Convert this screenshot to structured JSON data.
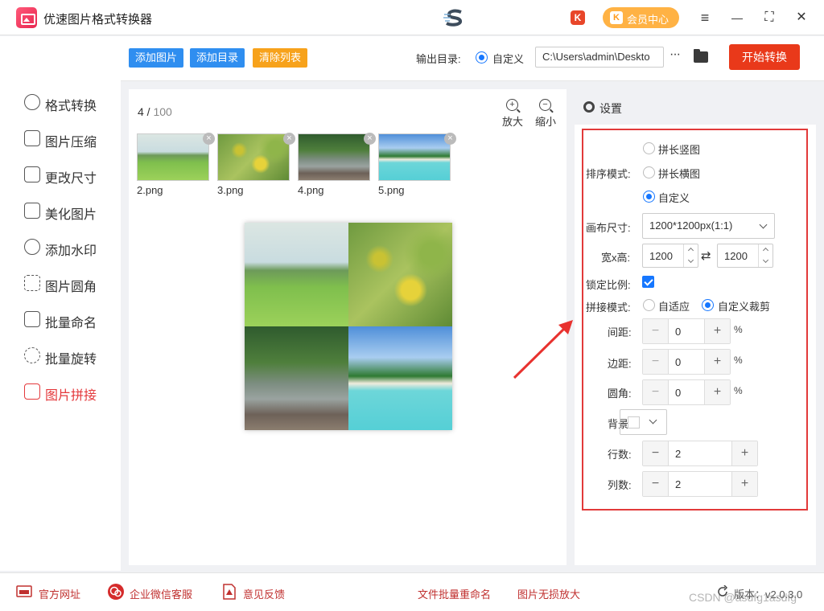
{
  "app": {
    "title": "优速图片格式转换器",
    "center_logo_text": "ら"
  },
  "titlebar": {
    "vip_label": "会员中心",
    "k_badge": "K",
    "menu_glyph": "≡",
    "min_glyph": "—",
    "max_glyph": "⛶",
    "close_glyph": "✕"
  },
  "sidebar": {
    "items": [
      {
        "label": "格式转换",
        "icon": "format-convert-icon"
      },
      {
        "label": "图片压缩",
        "icon": "compress-icon"
      },
      {
        "label": "更改尺寸",
        "icon": "resize-icon"
      },
      {
        "label": "美化图片",
        "icon": "beautify-icon"
      },
      {
        "label": "添加水印",
        "icon": "watermark-icon"
      },
      {
        "label": "图片圆角",
        "icon": "round-corner-icon"
      },
      {
        "label": "批量命名",
        "icon": "rename-icon"
      },
      {
        "label": "批量旋转",
        "icon": "rotate-icon"
      },
      {
        "label": "图片拼接",
        "icon": "stitch-icon",
        "active": true
      }
    ]
  },
  "toolbar": {
    "add_image": "添加图片",
    "add_dir": "添加目录",
    "clear_list": "清除列表",
    "output_label": "输出目录:",
    "output_mode": "自定义",
    "output_path": "C:\\Users\\admin\\Deskto",
    "more_glyph": "···",
    "start": "开始转换",
    "colors": {
      "add": "#2f8ef0",
      "clear": "#f7a21b",
      "start": "#e9391a"
    }
  },
  "image_panel": {
    "count": "4",
    "count_sep": " / ",
    "max": "100",
    "zoom_in": "放大",
    "zoom_out": "缩小",
    "thumbnails": [
      {
        "name": "2.png"
      },
      {
        "name": "3.png"
      },
      {
        "name": "4.png"
      },
      {
        "name": "5.png"
      }
    ],
    "remove_glyph": "×"
  },
  "settings": {
    "title": "设置",
    "sort_label": "排序模式:",
    "sort_options": [
      "拼长竖图",
      "拼长横图",
      "自定义"
    ],
    "sort_selected": "自定义",
    "canvas_label": "画布尺寸:",
    "canvas_value": "1200*1200px(1:1)",
    "wh_label": "宽x高:",
    "width": "1200",
    "height": "1200",
    "swap_glyph": "⇄",
    "lock_label": "锁定比例:",
    "lock_checked": true,
    "stitch_label": "拼接模式:",
    "stitch_options": [
      "自适应",
      "自定义裁剪"
    ],
    "stitch_selected": "自定义裁剪",
    "spacing_label": "间距:",
    "spacing": "0",
    "margin_label": "边距:",
    "margin": "0",
    "radius_label": "圆角:",
    "radius": "0",
    "percent": "%",
    "bg_label": "背景:",
    "bg_color": "#ffffff",
    "rows_label": "行数:",
    "rows": "2",
    "cols_label": "列数:",
    "cols": "2",
    "minus": "−",
    "plus": "+"
  },
  "footer": {
    "official_site": "官方网址",
    "wechat_service": "企业微信客服",
    "feedback": "意见反馈",
    "batch_rename": "文件批量重命名",
    "lossless_zoom": "图片无损放大",
    "version": "版本：v2.0.3.0",
    "watermark": "CSDN @asdfg1asdfg"
  }
}
